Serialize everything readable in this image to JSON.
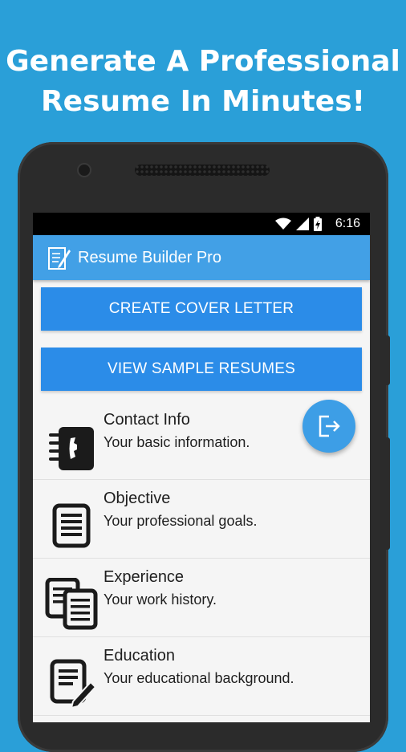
{
  "headline": {
    "line1": "Generate A Professional",
    "line2": "Resume In Minutes!"
  },
  "status_bar": {
    "time": "6:16",
    "icons": [
      "wifi-icon",
      "cell-signal-icon",
      "battery-charging-icon"
    ]
  },
  "app_bar": {
    "title": "Resume Builder Pro",
    "icon": "notepad-edit-icon"
  },
  "buttons": {
    "create_cover_letter": "CREATE COVER LETTER",
    "view_sample_resumes": "VIEW SAMPLE RESUMES"
  },
  "fab": {
    "icon": "exit-icon"
  },
  "sections": [
    {
      "title": "Contact Info",
      "subtitle": "Your basic information.",
      "icon": "contact-book-icon"
    },
    {
      "title": "Objective",
      "subtitle": "Your professional goals.",
      "icon": "document-icon"
    },
    {
      "title": "Experience",
      "subtitle": "Your work history.",
      "icon": "documents-stack-icon"
    },
    {
      "title": "Education",
      "subtitle": "Your educational background.",
      "icon": "document-edit-icon"
    }
  ],
  "colors": {
    "background": "#2a9fd8",
    "app_bar": "#42a0e6",
    "button": "#2b8ce8",
    "fab": "#3d9ee6"
  }
}
